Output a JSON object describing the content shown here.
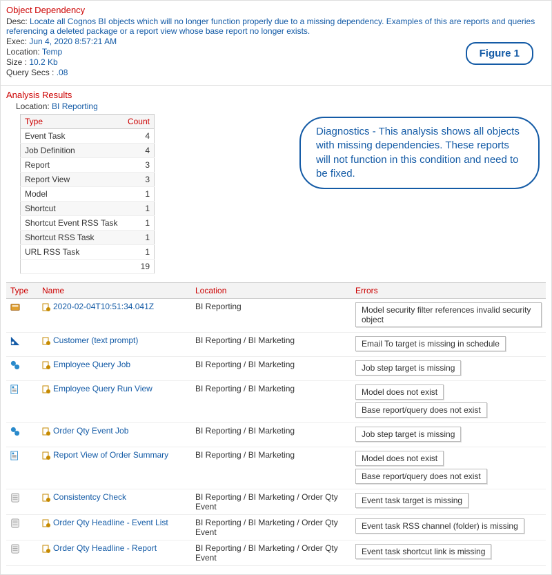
{
  "header": {
    "title": "Object Dependency",
    "desc_label": "Desc:",
    "desc": "Locate all Cognos BI objects which will no longer function properly due to a missing dependency. Examples of this are reports and queries referencing a deleted package or a report view whose base report no longer exists.",
    "exec_label": "Exec:",
    "exec": "Jun 4, 2020 8:57:21 AM",
    "location_label": "Location:",
    "location": "Temp",
    "size_label": "Size :",
    "size": "10.2 Kb",
    "query_secs_label": "Query Secs :",
    "query_secs": ".08",
    "figure_label": "Figure 1"
  },
  "analysis": {
    "title": "Analysis Results",
    "location_label": "Location:",
    "location": "BI Reporting",
    "summary_headers": {
      "type": "Type",
      "count": "Count"
    },
    "summary": [
      {
        "type": "Event Task",
        "count": 4
      },
      {
        "type": "Job Definition",
        "count": 4
      },
      {
        "type": "Report",
        "count": 3
      },
      {
        "type": "Report View",
        "count": 3
      },
      {
        "type": "Model",
        "count": 1
      },
      {
        "type": "Shortcut",
        "count": 1
      },
      {
        "type": "Shortcut Event RSS Task",
        "count": 1
      },
      {
        "type": "Shortcut RSS Task",
        "count": 1
      },
      {
        "type": "URL RSS Task",
        "count": 1
      }
    ],
    "summary_total": 19,
    "callout": "Diagnostics - This analysis shows all objects with missing dependencies. These reports will not function in this condition and need to be fixed."
  },
  "results": {
    "headers": {
      "type": "Type",
      "name": "Name",
      "location": "Location",
      "errors": "Errors"
    },
    "rows": [
      {
        "icon": "model",
        "icon_color": "#e0a030",
        "name": "2020-02-04T10:51:34.041Z",
        "location": "BI Reporting",
        "errors": [
          "Model security filter references invalid security object"
        ]
      },
      {
        "icon": "report",
        "icon_color": "#145ba6",
        "name": "Customer (text prompt)",
        "location": "BI Reporting / BI Marketing",
        "errors": [
          "Email To target is missing in schedule"
        ]
      },
      {
        "icon": "job",
        "icon_color": "#2a8acb",
        "name": "Employee Query Job",
        "location": "BI Reporting / BI Marketing",
        "errors": [
          "Job step target is missing"
        ]
      },
      {
        "icon": "report-view",
        "icon_color": "#2a8acb",
        "name": "Employee Query Run View",
        "location": "BI Reporting / BI Marketing",
        "errors": [
          "Model does not exist",
          "Base report/query does not exist"
        ]
      },
      {
        "icon": "job",
        "icon_color": "#2a8acb",
        "name": "Order Qty Event Job",
        "location": "BI Reporting / BI Marketing",
        "errors": [
          "Job step target is missing"
        ]
      },
      {
        "icon": "report-view",
        "icon_color": "#2a8acb",
        "name": "Report View of Order Summary",
        "location": "BI Reporting / BI Marketing",
        "errors": [
          "Model does not exist",
          "Base report/query does not exist"
        ]
      },
      {
        "icon": "event",
        "icon_color": "#888",
        "name": "Consistentcy Check",
        "location": "BI Reporting / BI Marketing / Order Qty Event",
        "errors": [
          "Event task target is missing"
        ]
      },
      {
        "icon": "event",
        "icon_color": "#888",
        "name": "Order Qty Headline - Event List",
        "location": "BI Reporting / BI Marketing / Order Qty Event",
        "errors": [
          "Event task RSS channel (folder) is missing"
        ]
      },
      {
        "icon": "event",
        "icon_color": "#888",
        "name": "Order Qty Headline - Report",
        "location": "BI Reporting / BI Marketing / Order Qty Event",
        "errors": [
          "Event task shortcut link is missing"
        ]
      }
    ]
  }
}
